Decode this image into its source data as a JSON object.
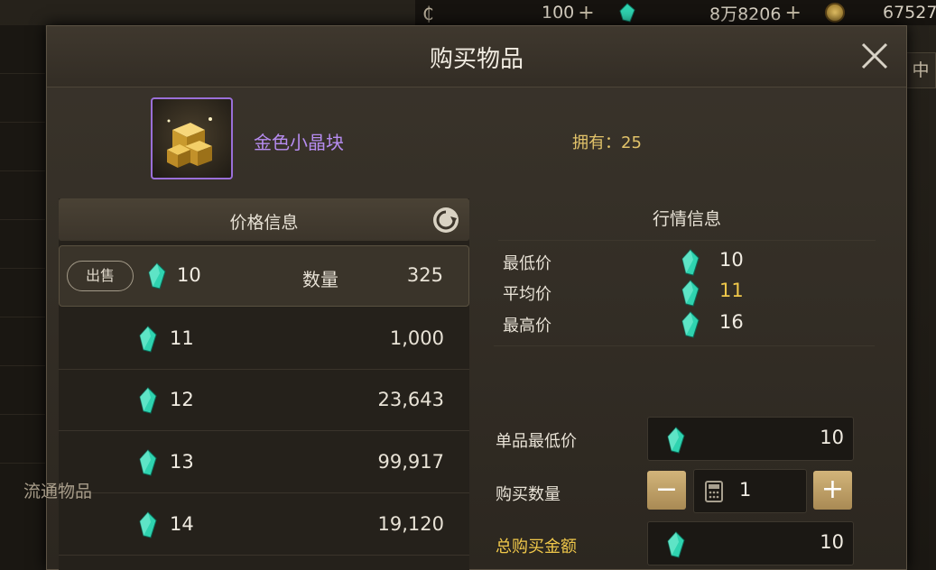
{
  "topbar": {
    "currency1_value": "100",
    "currency2_value": "8万8206",
    "currency3_value": "67527"
  },
  "background": {
    "left_label": "流通物品",
    "right_tab": "中"
  },
  "dialog": {
    "title": "购买物品",
    "item_name": "金色小晶块",
    "owned_label": "拥有：25"
  },
  "price_panel": {
    "title": "价格信息",
    "sell_label": "出售",
    "qty_label": "数量",
    "rows": [
      {
        "price": "10",
        "qty": "325"
      },
      {
        "price": "11",
        "qty": "1,000"
      },
      {
        "price": "12",
        "qty": "23,643"
      },
      {
        "price": "13",
        "qty": "99,917"
      },
      {
        "price": "14",
        "qty": "19,120"
      }
    ]
  },
  "market_panel": {
    "title": "行情信息",
    "rows": [
      {
        "label": "最低价",
        "value": "10"
      },
      {
        "label": "平均价",
        "value": "11"
      },
      {
        "label": "最高价",
        "value": "16"
      }
    ]
  },
  "purchase_form": {
    "unit_price_label": "单品最低价",
    "unit_price_value": "10",
    "qty_label": "购买数量",
    "qty_value": "1",
    "total_label": "总购买金额",
    "total_value": "10"
  },
  "colors": {
    "accent_purple": "#b68cf0",
    "accent_gold": "#f0c84a",
    "gem_teal": "#2fd3b0"
  }
}
